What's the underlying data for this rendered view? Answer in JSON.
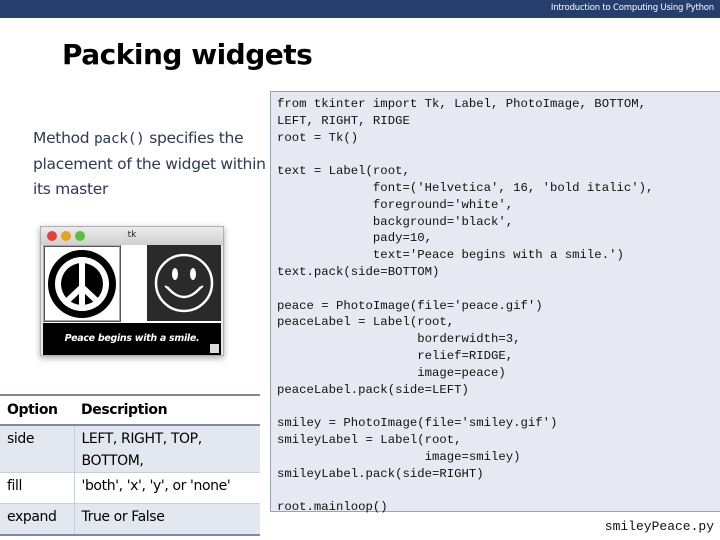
{
  "header": {
    "course_title": "Introduction to Computing Using Python",
    "bar_color": "#263e6b"
  },
  "slide": {
    "title": "Packing widgets",
    "description": {
      "prefix": "Method ",
      "code": "pack()",
      "suffix": " specifies the placement of the widget within its master"
    }
  },
  "tk_window": {
    "title": "tk",
    "traffic_lights": [
      "#e0443e",
      "#e5a323",
      "#5cbf3e"
    ],
    "label_text": "Peace begins with a smile."
  },
  "options_table": {
    "headers": [
      "Option",
      "Description"
    ],
    "rows": [
      {
        "option": "side",
        "description": "LEFT, RIGHT, TOP, BOTTOM,"
      },
      {
        "option": "fill",
        "description": "'both', 'x', 'y', or 'none'"
      },
      {
        "option": "expand",
        "description": "True or False"
      }
    ]
  },
  "code": {
    "lines": [
      "from tkinter import Tk, Label, PhotoImage, BOTTOM,",
      "LEFT, RIGHT, RIDGE",
      "root = Tk()",
      "",
      "text = Label(root,",
      "             font=('Helvetica', 16, 'bold italic'),",
      "             foreground='white',",
      "             background='black',",
      "             pady=10,",
      "             text='Peace begins with a smile.')",
      "text.pack(side=BOTTOM)",
      "",
      "peace = PhotoImage(file='peace.gif')",
      "peaceLabel = Label(root,",
      "                   borderwidth=3,",
      "                   relief=RIDGE,",
      "                   image=peace)",
      "peaceLabel.pack(side=LEFT)",
      "",
      "smiley = PhotoImage(file='smiley.gif')",
      "smileyLabel = Label(root,",
      "                    image=smiley)",
      "smileyLabel.pack(side=RIGHT)",
      "",
      "root.mainloop()"
    ],
    "filename": "smileyPeace.py"
  }
}
